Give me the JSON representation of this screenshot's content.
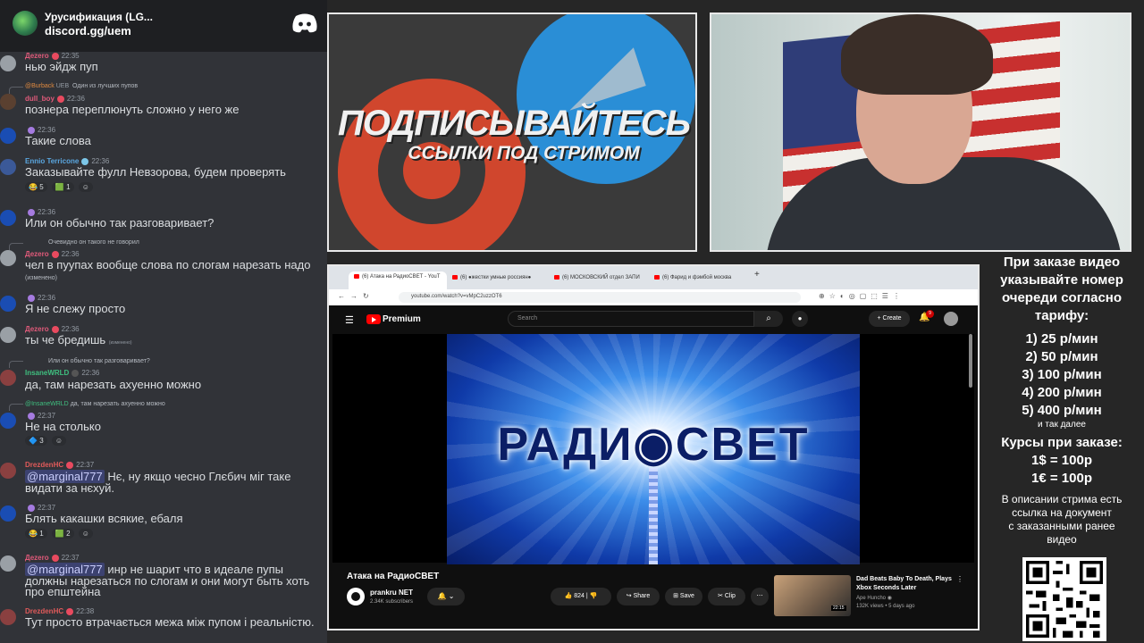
{
  "chat": {
    "server_name": "Урусификация (LG...",
    "invite": "discord.gg/uem",
    "messages": [
      {
        "user": "Дezero",
        "time": "22:35",
        "text": "нью эйдж пуп"
      },
      {
        "reply_user": "@Burback",
        "reply_tag": "UEB",
        "reply_text": "Один из лучших пупов",
        "user": "dull_boy",
        "time": "22:36",
        "text": "познера переплюнуть сложно у него же"
      },
      {
        "user": "",
        "time": "22:36",
        "text": "Такие слова"
      },
      {
        "user": "Ennio Terricone",
        "time": "22:36",
        "text": "Заказывайте фулл Невзорова, будем проверять",
        "reactions": [
          "5",
          "1"
        ]
      },
      {
        "user": "",
        "time": "22:36",
        "text": "Или он обычно так разговаривает?"
      },
      {
        "reply_text": "Очевидно он такого не говорил",
        "user": "Дezero",
        "time": "22:36",
        "text": "чел в пуупах вообще слова по слогам нарезать надо",
        "edited": "(изменено)"
      },
      {
        "user": "",
        "time": "22:36",
        "text": "Я не слежу просто"
      },
      {
        "user": "Дezero",
        "time": "22:36",
        "text": "ты че бредишь",
        "edited": "(изменено)"
      },
      {
        "reply_text": "Или он обычно так разговаривает?",
        "user": "InsaneWRLD",
        "time": "22:36",
        "text": "да, там нарезать ахуенно можно"
      },
      {
        "reply_user": "@InsaneWRLD",
        "reply_text": "да, там нарезать ахуенно можно",
        "user": "",
        "time": "22:37",
        "text": "Не на столько",
        "reactions": [
          "3"
        ]
      },
      {
        "user": "DrezdenHC",
        "time": "22:37",
        "mention": "@marginal777",
        "text": "Нє, ну якщо чесно Глєбич міг таке",
        "text2": "видати за нєхуй."
      },
      {
        "user": "",
        "time": "22:37",
        "text": "Блять какашки всякие, ебаля",
        "reactions": [
          "1",
          "2"
        ]
      },
      {
        "user": "Дezero",
        "time": "22:37",
        "mention": "@marginal777",
        "text": "инр не шарит что в идеале пупы",
        "text2": "должны нарезаться по слогам и они могут быть хоть",
        "text3": "про епштейна"
      },
      {
        "user": "DrezdenHC",
        "time": "22:38",
        "text": "Тут просто втрачається межа між пупом і реальністю."
      }
    ]
  },
  "banner": {
    "title": "ПОДПИСЫВАЙТЕСЬ",
    "subtitle": "ССЫЛКИ ПОД СТРИМОМ"
  },
  "browser": {
    "tabs": [
      "(6) Атака на РадиоСВЕТ - YouT",
      "(6) ●жестки умные россиян●",
      "(6) МОСКОВСКИЙ отдел ЗАПИ",
      "(6) Фарид и фэмбой москва",
      "+"
    ],
    "url": "youtube.com/watch?v=vMpC2uzzOT6",
    "youtube": {
      "premium_label": "Premium",
      "search_placeholder": "Search",
      "create_label": "Create",
      "notif_count": "9",
      "video_overlay": "РАДИ◉СВЕТ",
      "video_title": "Атака на РадиоСВЕТ",
      "channel_name": "prankru NET",
      "channel_subs": "2.34K subscribers",
      "likes": "824",
      "share_label": "Share",
      "save_label": "Save",
      "clip_label": "Clip",
      "rec_title": "Dad Beats Baby To Death, Plays Xbox Seconds Later",
      "rec_channel": "Ape Huncho ◉",
      "rec_meta": "132K views • 5 days ago",
      "rec_duration": "22:15"
    }
  },
  "info": {
    "line1": "При заказе видео",
    "line2": "указывайте номер",
    "line3": "очереди согласно",
    "line4": "тарифу:",
    "tariffs": [
      "1) 25 р/мин",
      "2) 50 р/мин",
      "3) 100 р/мин",
      "4) 200 р/мин",
      "5) 400 р/мин"
    ],
    "etc": "и так далее",
    "rates_title": "Курсы при заказе:",
    "rate1": "1$ = 100р",
    "rate2": "1€ = 100р",
    "desc1": "В описании стрима есть",
    "desc2": "ссылка на документ",
    "desc3": "с заказанными ранее",
    "desc4": "видео"
  }
}
